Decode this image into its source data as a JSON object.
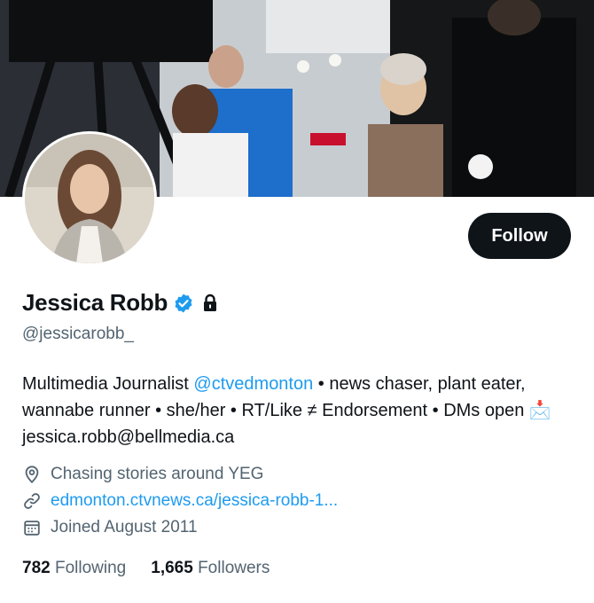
{
  "profile": {
    "display_name": "Jessica Robb",
    "handle": "@jessicarobb_",
    "follow_label": "Follow",
    "bio": {
      "part1": "Multimedia Journalist ",
      "mention": "@ctvedmonton",
      "part2": " • news chaser, plant eater, wannabe runner • she/her • RT/Like ≠ Endorsement • DMs open ",
      "emoji": "📩",
      "part3": " jessica.robb@bellmedia.ca"
    },
    "location": "Chasing stories around YEG",
    "website": "edmonton.ctvnews.ca/jessica-robb-1...",
    "joined": "Joined August 2011",
    "following_count": "782",
    "following_label": "Following",
    "followers_count": "1,665",
    "followers_label": "Followers"
  },
  "icons": {
    "verified": "verified-badge-icon",
    "protected": "lock-icon",
    "location": "location-pin-icon",
    "link": "link-icon",
    "calendar": "calendar-icon"
  },
  "colors": {
    "accent": "#1d9bf0",
    "text_primary": "#0f1419",
    "text_secondary": "#536471",
    "button_bg": "#0f1419"
  }
}
